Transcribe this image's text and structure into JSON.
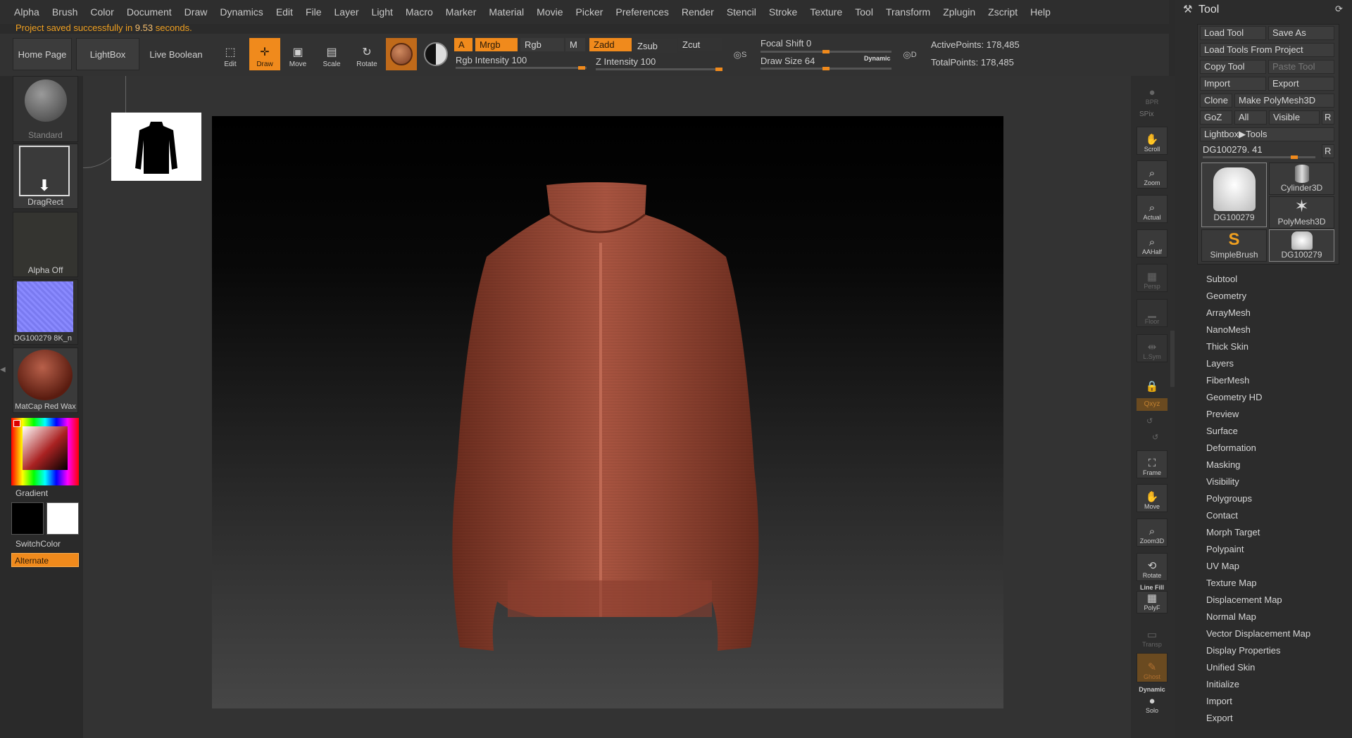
{
  "menu": [
    "Alpha",
    "Brush",
    "Color",
    "Document",
    "Draw",
    "Dynamics",
    "Edit",
    "File",
    "Layer",
    "Light",
    "Macro",
    "Marker",
    "Material",
    "Movie",
    "Picker",
    "Preferences",
    "Render",
    "Stencil",
    "Stroke",
    "Texture",
    "Tool",
    "Transform",
    "Zplugin",
    "Zscript",
    "Help"
  ],
  "status": {
    "prefix": "Project saved successfully in ",
    "time": "9.53",
    "suffix": " seconds."
  },
  "toolbar": {
    "home_page": "Home Page",
    "lightbox": "LightBox",
    "live_boolean": "Live Boolean",
    "edit": "Edit",
    "draw": "Draw",
    "move": "Move",
    "scale": "Scale",
    "rotate": "Rotate",
    "a": "A",
    "mrgb": "Mrgb",
    "rgb": "Rgb",
    "m": "M",
    "zadd": "Zadd",
    "zsub": "Zsub",
    "zcut": "Zcut",
    "rgb_intensity_label": "Rgb Intensity",
    "rgb_intensity": "100",
    "z_intensity_label": "Z Intensity",
    "z_intensity": "100",
    "focal_shift_label": "Focal Shift",
    "focal_shift": "0",
    "draw_size_label": "Draw Size",
    "draw_size": "64",
    "dynamic": "Dynamic",
    "s": "S",
    "d": "D",
    "active_points": "ActivePoints: 178,485",
    "total_points": "TotalPoints: 178,485"
  },
  "leftshelf": {
    "brush": "Standard",
    "stroke": "DragRect",
    "alpha": "Alpha Off",
    "texture": "DG100279 8K_n",
    "material": "MatCap Red Wax",
    "gradient": "Gradient",
    "switch_color": "SwitchColor",
    "alternate": "Alternate"
  },
  "rightshelf": {
    "bpr": "BPR",
    "spix": "SPix",
    "scroll": "Scroll",
    "zoom": "Zoom",
    "actual": "Actual",
    "aahalf": "AAHalf",
    "persp": "Persp",
    "floor": "Floor",
    "lsym": "L.Sym",
    "xyz": "Qxyz",
    "frame": "Frame",
    "move": "Move",
    "zoom3d": "Zoom3D",
    "rotate": "Rotate",
    "linefill": "Line Fill",
    "polyf": "PolyF",
    "transp": "Transp",
    "ghost": "Ghost",
    "dynamic": "Dynamic",
    "solo": "Solo"
  },
  "tool": {
    "title": "Tool",
    "load_tool": "Load Tool",
    "save_as": "Save As",
    "load_from_project": "Load Tools From Project",
    "copy_tool": "Copy Tool",
    "paste_tool": "Paste Tool",
    "import": "Import",
    "export": "Export",
    "clone": "Clone",
    "make_polymesh": "Make PolyMesh3D",
    "goz": "GoZ",
    "all": "All",
    "visible": "Visible",
    "r": "R",
    "lightbox_tools": "Lightbox▶Tools",
    "current_tool": "DG100279. 41",
    "thumbs": [
      "DG100279",
      "Cylinder3D",
      "PolyMesh3D",
      "SimpleBrush",
      "DG100279"
    ],
    "sections": [
      "Subtool",
      "Geometry",
      "ArrayMesh",
      "NanoMesh",
      "Thick Skin",
      "Layers",
      "FiberMesh",
      "Geometry HD",
      "Preview",
      "Surface",
      "Deformation",
      "Masking",
      "Visibility",
      "Polygroups",
      "Contact",
      "Morph Target",
      "Polypaint",
      "UV Map",
      "Texture Map",
      "Displacement Map",
      "Normal Map",
      "Vector Displacement Map",
      "Display Properties",
      "Unified Skin",
      "Initialize",
      "Import",
      "Export"
    ]
  },
  "colors": {
    "accent": "#f08a1c",
    "jacket": "#9c4a36"
  }
}
